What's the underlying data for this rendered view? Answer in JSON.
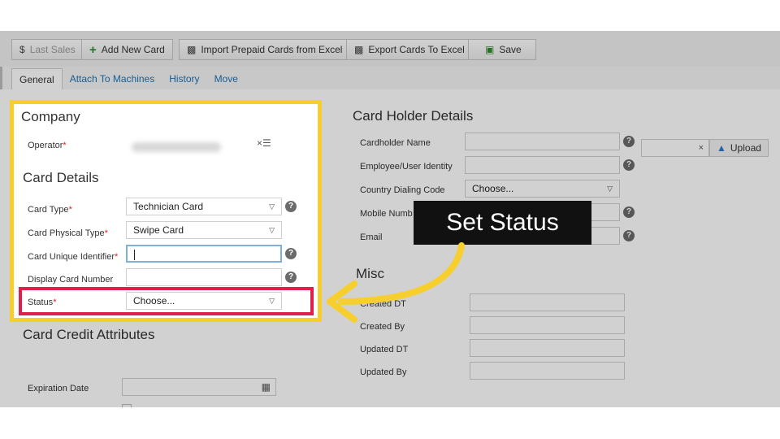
{
  "toolbar": {
    "buttons": [
      {
        "label": "Last Sales",
        "icon": "$"
      },
      {
        "label": "Add New Card",
        "icon": "+"
      },
      {
        "label": "Import Prepaid Cards from Excel",
        "icon": "excel"
      },
      {
        "label": "Export Cards To Excel",
        "icon": "excel"
      },
      {
        "label": "Save",
        "icon": "save"
      }
    ]
  },
  "tabs": [
    "General",
    "Attach To Machines",
    "History",
    "Move"
  ],
  "company": {
    "title": "Company",
    "operator_label": "Operator",
    "operator_clear": "×☰"
  },
  "card_details": {
    "title": "Card Details",
    "card_type_label": "Card Type",
    "card_type_value": "Technician Card",
    "physical_type_label": "Card Physical Type",
    "physical_type_value": "Swipe Card",
    "unique_id_label": "Card Unique Identifier",
    "display_number_label": "Display Card Number",
    "status_label": "Status",
    "status_value": "Choose..."
  },
  "card_credit": {
    "title": "Card Credit Attributes",
    "expiration_label": "Expiration Date"
  },
  "holder": {
    "title": "Card Holder Details",
    "name_label": "Cardholder Name",
    "employee_label": "Employee/User Identity",
    "country_label": "Country Dialing Code",
    "country_value": "Choose...",
    "mobile_label": "Mobile Numb",
    "email_label": "Email",
    "upload_label": "Upload",
    "upload_clear": "×"
  },
  "misc": {
    "title": "Misc",
    "created_dt_label": "Created DT",
    "created_by_label": "Created By",
    "updated_dt_label": "Updated DT",
    "updated_by_label": "Updated By"
  },
  "annotation": {
    "callout_text": "Set Status",
    "highlight_color": "#f6cf2f",
    "status_box_color": "#e21f4a",
    "arrow_color": "#f6cf2f"
  },
  "help_glyph": "?",
  "required_mark": "*"
}
